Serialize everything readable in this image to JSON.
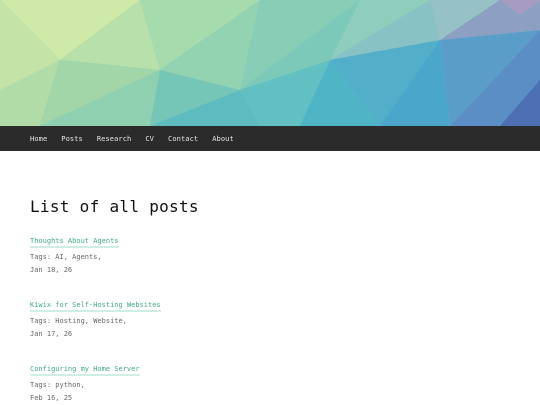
{
  "banner": {
    "colors": [
      "#c5e6a6",
      "#9dd6ad",
      "#7fc9b8",
      "#5fbac6",
      "#4aa9c8",
      "#5b8fc4",
      "#7d80b8"
    ]
  },
  "nav": {
    "items": [
      {
        "label": "Home"
      },
      {
        "label": "Posts"
      },
      {
        "label": "Research"
      },
      {
        "label": "CV"
      },
      {
        "label": "Contact"
      },
      {
        "label": "About"
      }
    ]
  },
  "main": {
    "title": "List of all posts",
    "posts": [
      {
        "title": "Thoughts About Agents",
        "tags": "Tags: AI, Agents,",
        "date": "Jan 18, 26"
      },
      {
        "title": "Kiwix for Self-Hosting Websites",
        "tags": "Tags: Hosting, Website,",
        "date": "Jan 17, 26"
      },
      {
        "title": "Configuring my Home Server",
        "tags": "Tags: python,",
        "date": "Feb 16, 25"
      }
    ]
  },
  "colors": {
    "link": "#3fa88a",
    "link_underline": "#cfeee3",
    "navbar": "#2b2b2b"
  }
}
